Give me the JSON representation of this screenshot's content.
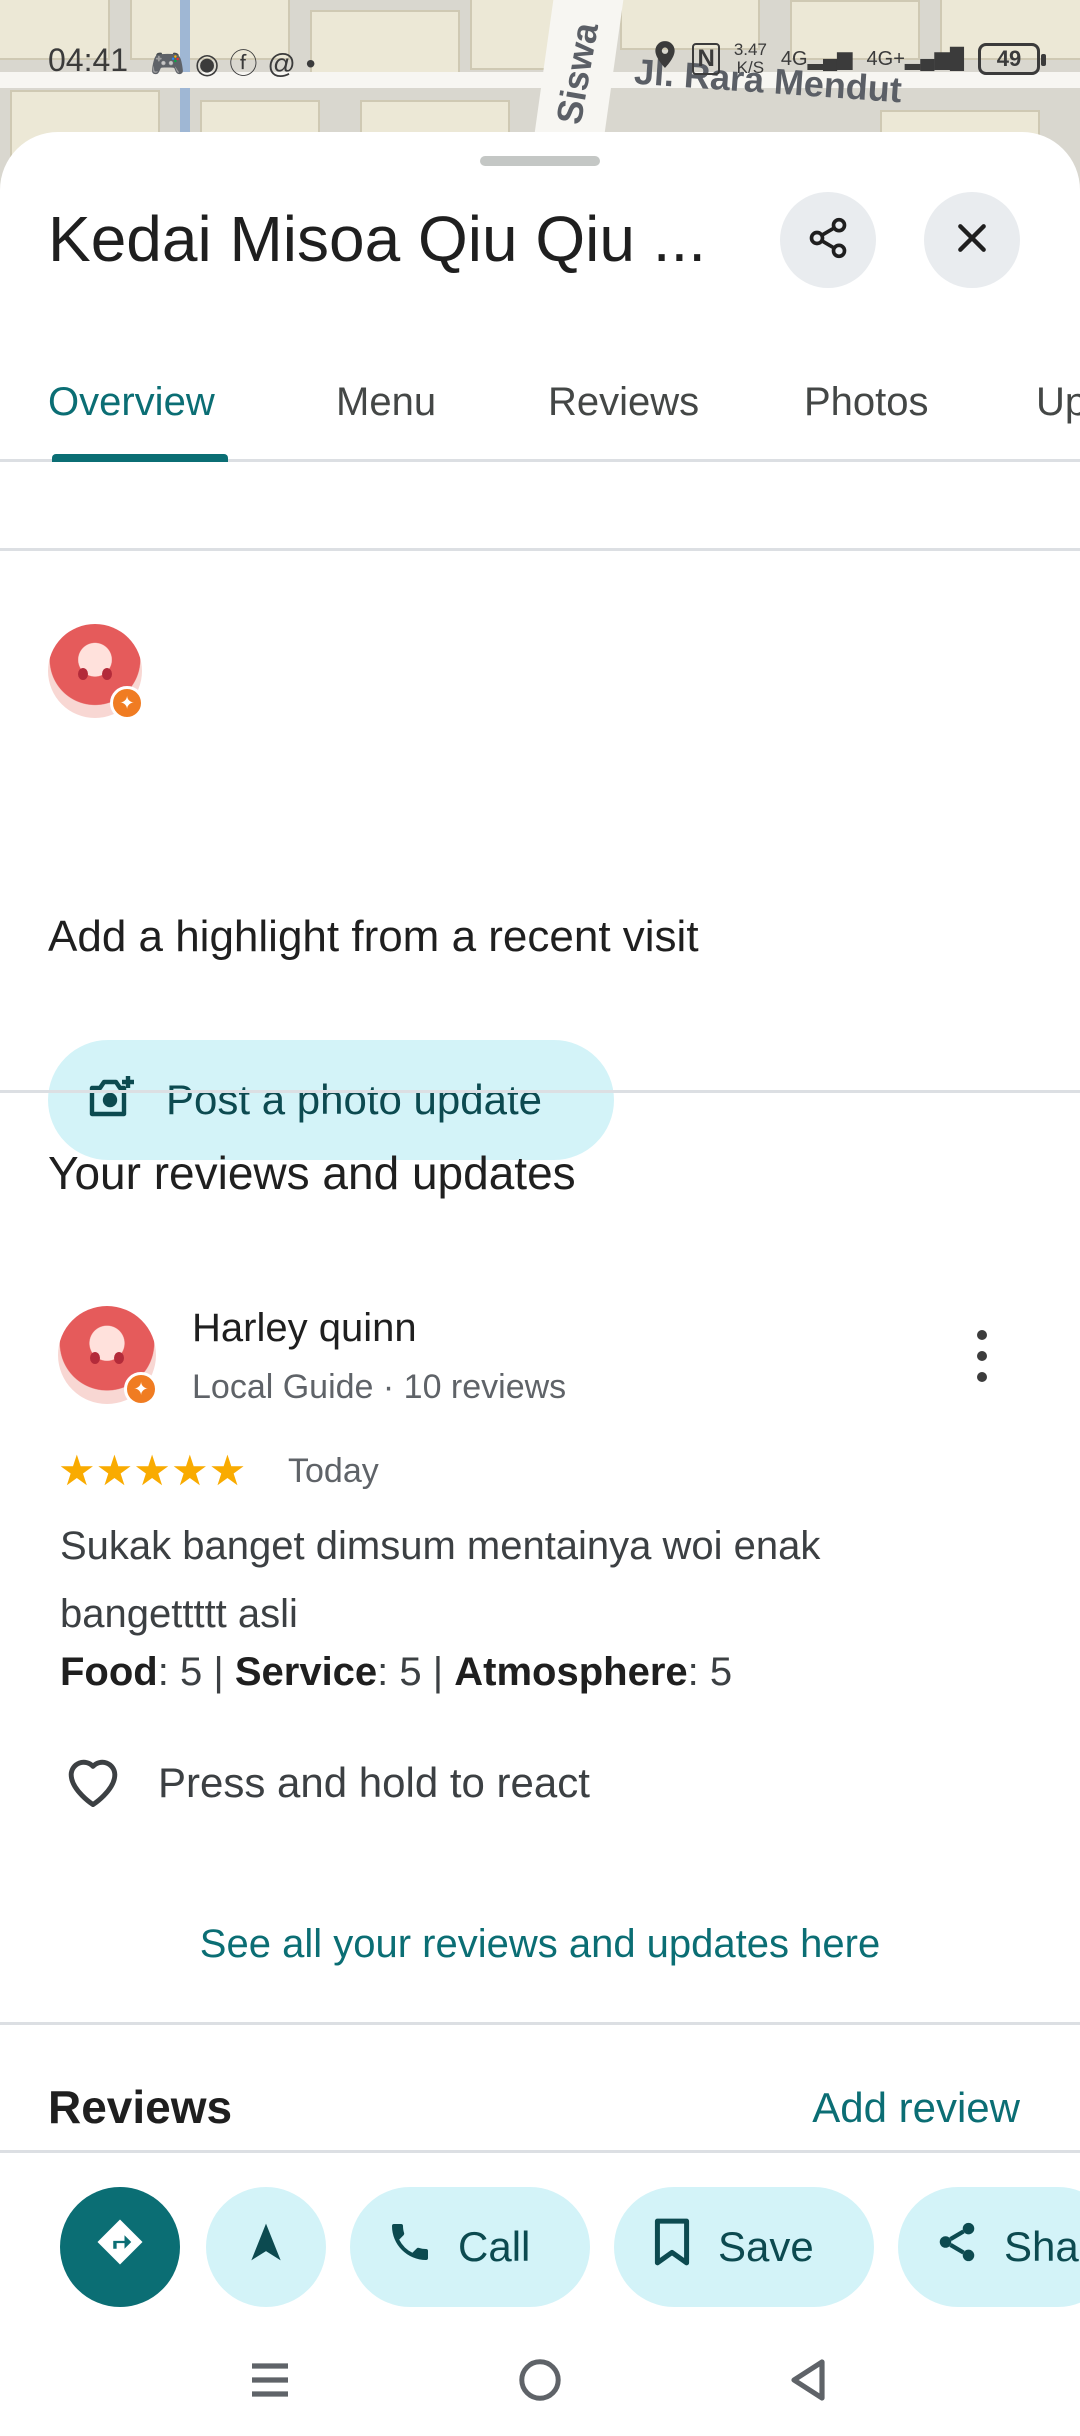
{
  "status_bar": {
    "time": "04:41",
    "speed": "3.47",
    "speed_unit": "K/S",
    "network1": "4G",
    "network2": "4G+",
    "battery": "49"
  },
  "map": {
    "street_label_1": "Siswa",
    "street_label_2": "Jl. Rara Mendut"
  },
  "header": {
    "title": "Kedai Misoa Qiu Qiu ...",
    "share_icon": "share-icon",
    "close_icon": "close-icon"
  },
  "tabs": [
    {
      "label": "Overview",
      "active": true
    },
    {
      "label": "Menu",
      "active": false
    },
    {
      "label": "Reviews",
      "active": false
    },
    {
      "label": "Photos",
      "active": false
    },
    {
      "label": "Up",
      "active": false
    }
  ],
  "highlight": {
    "title": "Add a highlight from a recent visit",
    "button_label": "Post a photo update",
    "button_icon": "add-photo-icon"
  },
  "your_reviews": {
    "section_title": "Your reviews and updates",
    "reviewer_name": "Harley quinn",
    "reviewer_meta": "Local Guide · 10 reviews",
    "rating": 5,
    "stars": "★★★★★",
    "date": "Today",
    "text": "Sukak banget dimsum mentainya woi enak bangettttt asli",
    "food_label": "Food",
    "food_value": ": 5 | ",
    "service_label": "Service",
    "service_value": ": 5 | ",
    "atmosphere_label": "Atmosphere",
    "atmosphere_value": ": 5",
    "react_label": "Press and hold to react",
    "see_all": "See all your reviews and updates here"
  },
  "reviews_section": {
    "title": "Reviews",
    "add_review": "Add review"
  },
  "action_bar": {
    "call_label": "Call",
    "save_label": "Save",
    "share_label": "Sha"
  },
  "colors": {
    "accent": "#0b6e74",
    "chip_bg": "#d3f3f8",
    "star": "#f9ab00",
    "badge": "#f07c22"
  }
}
